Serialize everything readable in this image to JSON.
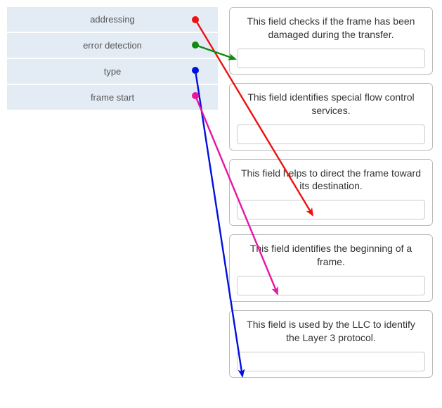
{
  "left": [
    {
      "id": "addressing",
      "label": "addressing",
      "matchesRightIndex": 2,
      "arrowColor": "#e11"
    },
    {
      "id": "error-detection",
      "label": "error detection",
      "matchesRightIndex": 0,
      "arrowColor": "#118a11"
    },
    {
      "id": "type",
      "label": "type",
      "matchesRightIndex": 4,
      "arrowColor": "#0010dd"
    },
    {
      "id": "frame-start",
      "label": "frame start",
      "matchesRightIndex": 3,
      "arrowColor": "#e815a2"
    }
  ],
  "right": [
    {
      "desc": "This field checks if the frame has been damaged during the transfer."
    },
    {
      "desc": "This field identifies special flow control services."
    },
    {
      "desc": "This field helps to direct the frame toward its destination."
    },
    {
      "desc": "This field identifies the beginning of a frame."
    },
    {
      "desc": "This field is used by the LLC to identify the Layer 3 protocol."
    }
  ],
  "colors": {
    "sourceBg": "#e3ecf5",
    "arrowRed": "#e11",
    "arrowGreen": "#118a11",
    "arrowBlue": "#0010dd",
    "arrowPink": "#e815a2"
  }
}
